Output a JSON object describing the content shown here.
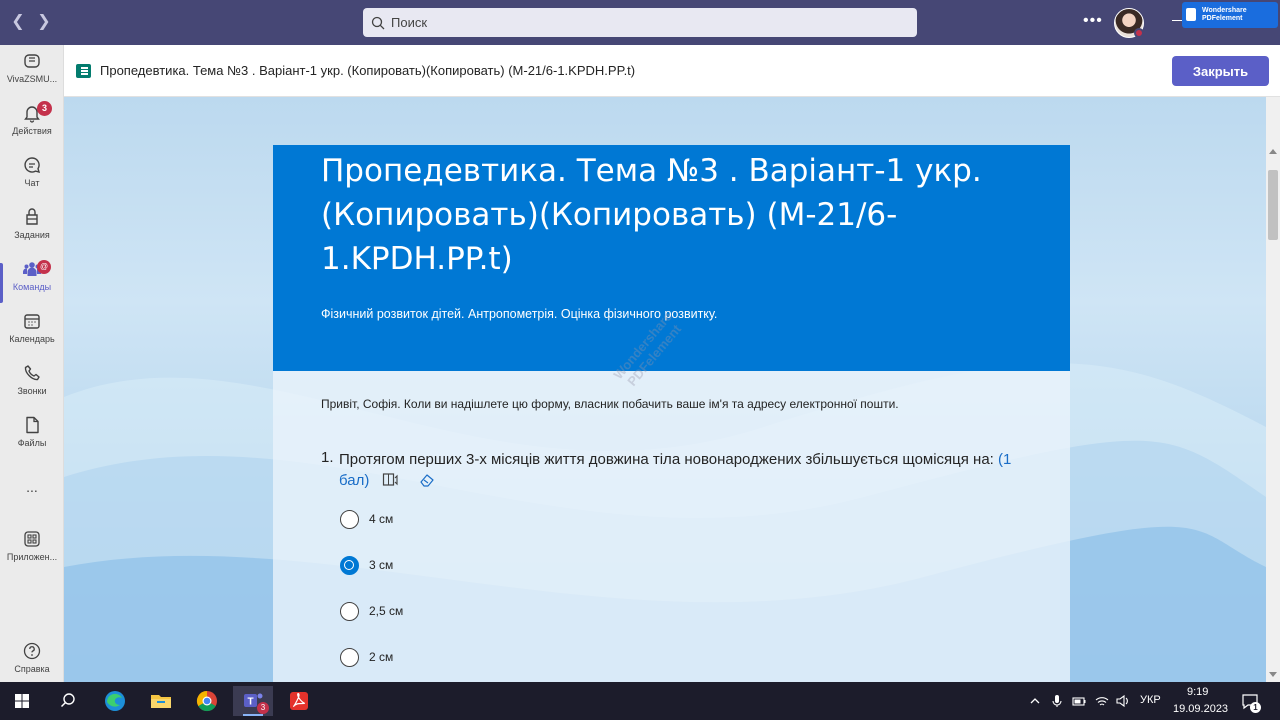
{
  "search": {
    "placeholder": "Поиск"
  },
  "wpdf_badge": {
    "line1": "Wondershare",
    "line2": "PDFelement"
  },
  "rail": {
    "items": [
      {
        "label": "VivaZSMU...",
        "icon": "viva-icon"
      },
      {
        "label": "Действия",
        "icon": "bell-icon",
        "badge": "3"
      },
      {
        "label": "Чат",
        "icon": "chat-icon"
      },
      {
        "label": "Задания",
        "icon": "assignments-icon"
      },
      {
        "label": "Команды",
        "icon": "teams-icon",
        "badge": "@"
      },
      {
        "label": "Календарь",
        "icon": "calendar-icon"
      },
      {
        "label": "Звонки",
        "icon": "phone-icon"
      },
      {
        "label": "Файлы",
        "icon": "file-icon"
      },
      {
        "label": "...",
        "icon": "more-icon"
      },
      {
        "label": "Приложен...",
        "icon": "apps-icon"
      },
      {
        "label": "Справка",
        "icon": "help-icon"
      }
    ]
  },
  "appbar": {
    "title": "Пропедевтика. Тема №3 . Варіант-1 укр. (Копировать)(Копировать) (М-21/6-1.KPDH.PP.t)",
    "close_label": "Закрыть"
  },
  "form": {
    "title": "Пропедевтика. Тема №3 . Варіант-1 укр. (Копировать)(Копировать) (М-21/6-1.KPDH.PP.t)",
    "description": "Фізичний розвиток дітей. Антропометрія. Оцінка фізичного розвитку.",
    "greeting": "Привіт, Софія. Коли ви надішлете цю форму, власник побачить ваше ім'я та адресу електронної пошти.",
    "question": {
      "number": "1.",
      "text": "Протягом перших 3-х місяців життя довжина тіла новонароджених збільшується щомісяця на:",
      "points": "(1 бал)",
      "options": [
        "4 см",
        "3 см",
        "2,5 см",
        "2 см"
      ],
      "selected_index": 1
    }
  },
  "watermark": {
    "line1": "Wondershare",
    "line2": "PDFelement"
  },
  "taskbar": {
    "apps": [
      "windows-start-icon",
      "search-icon",
      "edge-icon",
      "file-explorer-icon",
      "chrome-icon",
      "teams-icon",
      "acrobat-icon"
    ],
    "teams_badge": "3",
    "language": "УКР",
    "time": "9:19",
    "date": "19.09.2023",
    "notification_count": "1"
  },
  "colors": {
    "teams_purple": "#464775",
    "accent": "#5b5fc7",
    "form_blue": "#0078d4",
    "badge_red": "#c4314b"
  }
}
